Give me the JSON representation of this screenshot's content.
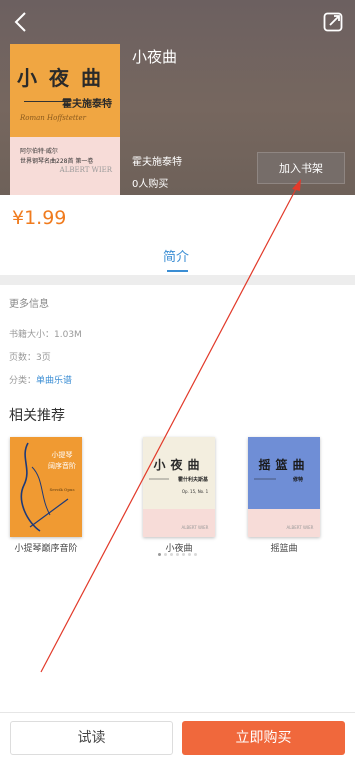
{
  "colors": {
    "accent": "#3b8ed4",
    "price": "#f07b1e",
    "buy": "#f0683c",
    "hero": "#6e6159"
  },
  "icons": {
    "back": "chevron-left-icon",
    "share": "share-icon"
  },
  "header": {
    "title": "小夜曲",
    "author": "霍夫施泰特",
    "bought": "0人购买",
    "add_to_shelf": "加入书架"
  },
  "cover": {
    "title": "小夜曲",
    "author": "霍夫施泰特",
    "subtitle": "Roman Hoffstetter",
    "line1": "阿尔伯特·威尔",
    "line2": "世界钢琴名曲228首 第一卷",
    "brand": "ALBERT WIER"
  },
  "price": "¥1.99",
  "tab": "简介",
  "info": {
    "heading": "更多信息",
    "size": "书籍大小：1.03M",
    "pages": "页数：3页",
    "category_label": "分类：",
    "category_value": "单曲乐谱"
  },
  "related": {
    "heading": "相关推荐",
    "books": [
      {
        "caption": "小提琴巅序音阶",
        "cover_title": "小提琴\n阔序音阶",
        "cover_sub": "Sevcik Opus"
      },
      {
        "caption": "小夜曲",
        "cover_title": "小夜曲",
        "cover_author": "霍什利夫斯基",
        "cover_op": "Op. 15, No. 1",
        "brand": "ALBERT WIER"
      },
      {
        "caption": "摇篮曲",
        "cover_title": "摇篮曲",
        "cover_author": "修特",
        "brand": "ALBERT WIER"
      }
    ]
  },
  "footer": {
    "trial": "试读",
    "buy": "立即购买"
  }
}
